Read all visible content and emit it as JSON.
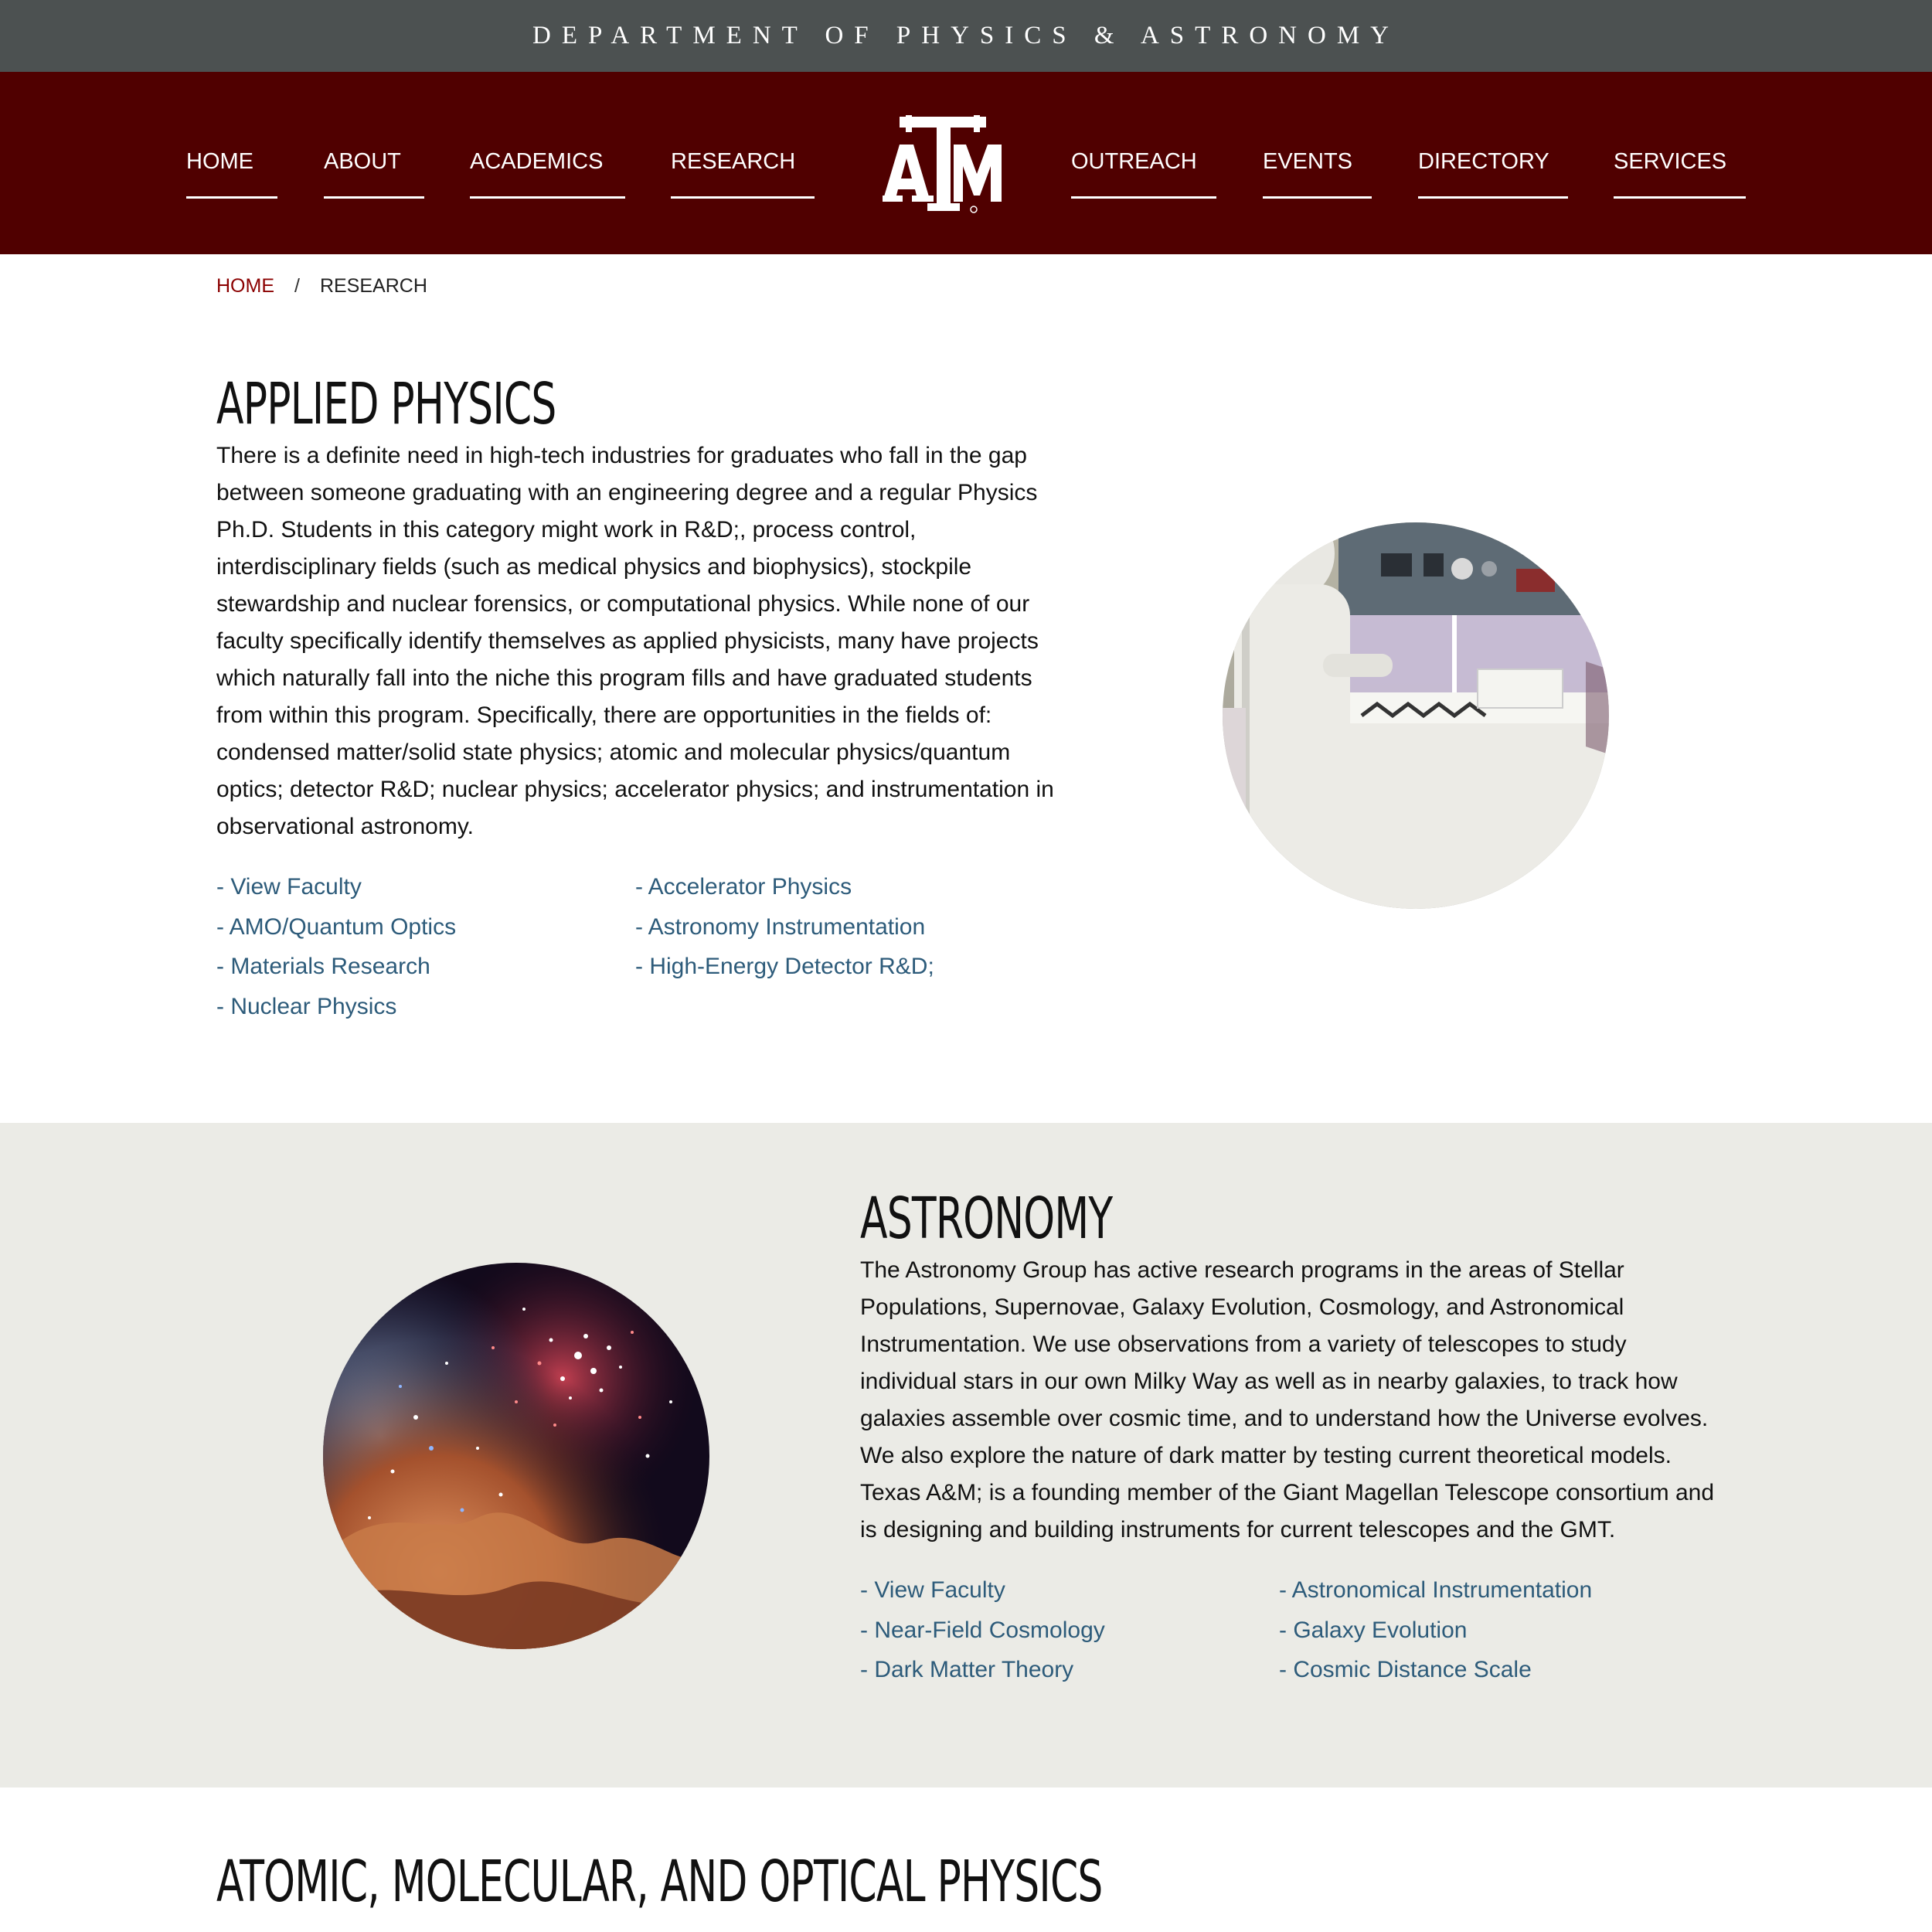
{
  "header": {
    "department": "DEPARTMENT OF PHYSICS & ASTRONOMY",
    "logo_text": "ATM"
  },
  "nav": {
    "left": [
      {
        "label": "HOME"
      },
      {
        "label": "ABOUT"
      },
      {
        "label": "ACADEMICS"
      },
      {
        "label": "RESEARCH"
      }
    ],
    "right": [
      {
        "label": "OUTREACH"
      },
      {
        "label": "EVENTS"
      },
      {
        "label": "DIRECTORY"
      },
      {
        "label": "SERVICES"
      }
    ]
  },
  "breadcrumb": {
    "home": "HOME",
    "separator": "/",
    "current": "RESEARCH"
  },
  "applied": {
    "title": "APPLIED PHYSICS",
    "body": "There is a definite need in high-tech industries for graduates who fall in the gap between someone graduating with an engineering degree and a regular Physics Ph.D. Students in this category might work in R&D;, process control, interdisciplinary fields (such as medical physics and biophysics), stockpile stewardship and nuclear forensics, or computational physics. While none of our faculty specifically identify themselves as applied physicists, many have projects which naturally fall into the niche this program fills and have graduated students from within this program. Specifically, there are opportunities in the fields of: condensed matter/solid state physics; atomic and molecular physics/quantum optics; detector R&D; nuclear physics; accelerator physics; and instrumentation in observational astronomy.",
    "links_col1": [
      "- View Faculty",
      "- AMO/Quantum Optics",
      "- Materials Research",
      "- Nuclear Physics"
    ],
    "links_col2": [
      "- Accelerator Physics",
      "- Astronomy Instrumentation",
      "- High-Energy Detector R&D;"
    ]
  },
  "astronomy": {
    "title": "ASTRONOMY",
    "body": "The Astronomy Group has active research programs in the areas of Stellar Populations, Supernovae, Galaxy Evolution, Cosmology, and Astronomical Instrumentation. We use observations from a variety of telescopes to study individual stars in our own Milky Way as well as in nearby galaxies, to track how galaxies assemble over cosmic time, and to understand how the Universe evolves. We also explore the nature of dark matter by testing current theoretical models. Texas A&M; is a founding member of the Giant Magellan Telescope consortium and is designing and building instruments for current telescopes and the GMT.",
    "links_col1": [
      "- View Faculty",
      "- Near-Field Cosmology",
      "- Dark Matter Theory"
    ],
    "links_col2": [
      "- Astronomical Instrumentation",
      "- Galaxy Evolution",
      "- Cosmic Distance Scale"
    ]
  },
  "amo": {
    "title": "ATOMIC, MOLECULAR, AND OPTICAL PHYSICS"
  },
  "colors": {
    "maroon": "#500000",
    "dept_bar": "#4c5151",
    "link": "#2d5b7a",
    "band": "#ebebe6"
  }
}
